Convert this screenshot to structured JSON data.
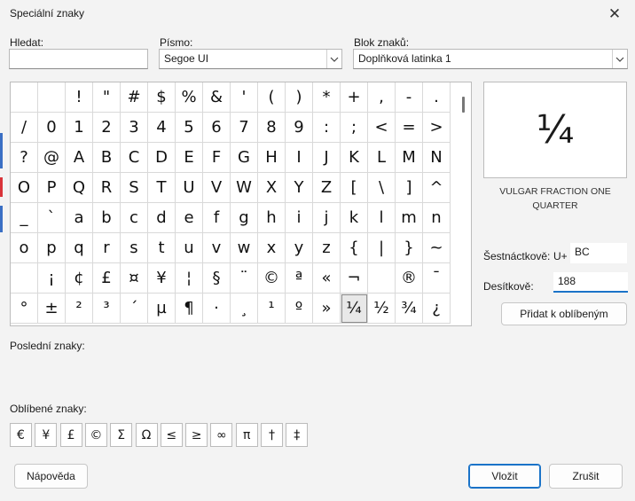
{
  "window": {
    "title": "Speciální znaky",
    "close_glyph": "✕"
  },
  "search": {
    "label": "Hledat:",
    "value": ""
  },
  "font": {
    "label": "Písmo:",
    "value": "Segoe UI"
  },
  "block": {
    "label": "Blok znaků:",
    "value": "Doplňková latinka 1"
  },
  "grid": {
    "cells": [
      " ",
      "!",
      "\"",
      "#",
      "$",
      "%",
      "&",
      "'",
      "(",
      ")",
      "*",
      "+",
      ",",
      "-",
      ".",
      "/",
      "0",
      "1",
      "2",
      "3",
      "4",
      "5",
      "6",
      "7",
      "8",
      "9",
      ":",
      ";",
      "<",
      "=",
      ">",
      "?",
      "@",
      "A",
      "B",
      "C",
      "D",
      "E",
      "F",
      "G",
      "H",
      "I",
      "J",
      "K",
      "L",
      "M",
      "N",
      "O",
      "P",
      "Q",
      "R",
      "S",
      "T",
      "U",
      "V",
      "W",
      "X",
      "Y",
      "Z",
      "[",
      "\\",
      "]",
      "^",
      "_",
      "`",
      "a",
      "b",
      "c",
      "d",
      "e",
      "f",
      "g",
      "h",
      "i",
      "j",
      "k",
      "l",
      "m",
      "n",
      "o",
      "p",
      "q",
      "r",
      "s",
      "t",
      "u",
      "v",
      "w",
      "x",
      "y",
      "z",
      "{",
      "|",
      "}",
      "~",
      "",
      "¡",
      "¢",
      "£",
      "¤",
      "¥",
      "¦",
      "§",
      "¨",
      "©",
      "ª",
      "«",
      "¬",
      "",
      "®",
      "¯",
      "°",
      "±",
      "²",
      "³",
      "´",
      "µ",
      "¶",
      "·",
      "¸",
      "¹",
      "º",
      "»",
      "¼",
      "½",
      "¾",
      "¿"
    ],
    "leading_blank": true,
    "selected_char": "¼"
  },
  "preview": {
    "char": "¼",
    "name": "VULGAR FRACTION ONE QUARTER"
  },
  "hex": {
    "label": "Šestnáctkově:",
    "prefix": "U+",
    "value": "BC"
  },
  "decimal": {
    "label": "Desítkově:",
    "value": "188"
  },
  "add_favorite_label": "Přidat k oblíbeným",
  "recent": {
    "label": "Poslední znaky:"
  },
  "favorites": {
    "label": "Oblíbené znaky:",
    "items": [
      "€",
      "¥",
      "£",
      "©",
      "Σ",
      "Ω",
      "≤",
      "≥",
      "∞",
      "π",
      "†",
      "‡"
    ]
  },
  "buttons": {
    "help": "Nápověda",
    "insert": "Vložit",
    "cancel": "Zrušit"
  },
  "colors": {
    "accent": "#1a73c8",
    "window_bg": "#f3f3f3"
  }
}
